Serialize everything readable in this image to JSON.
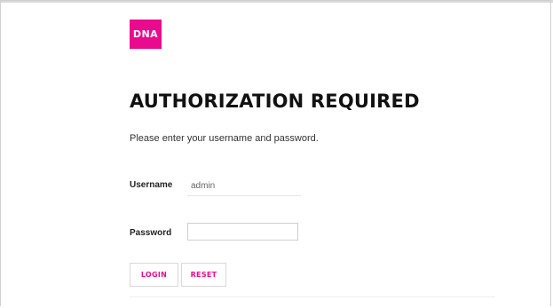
{
  "logo": {
    "text": "DNA",
    "color": "#ea0a8e"
  },
  "header": {
    "title": "AUTHORIZATION REQUIRED"
  },
  "form": {
    "instructions": "Please enter your username and password.",
    "username": {
      "label": "Username",
      "value": "admin"
    },
    "password": {
      "label": "Password",
      "value": ""
    },
    "login_label": "LOGIN",
    "reset_label": "RESET"
  },
  "colors": {
    "accent": "#ea0a8e"
  }
}
